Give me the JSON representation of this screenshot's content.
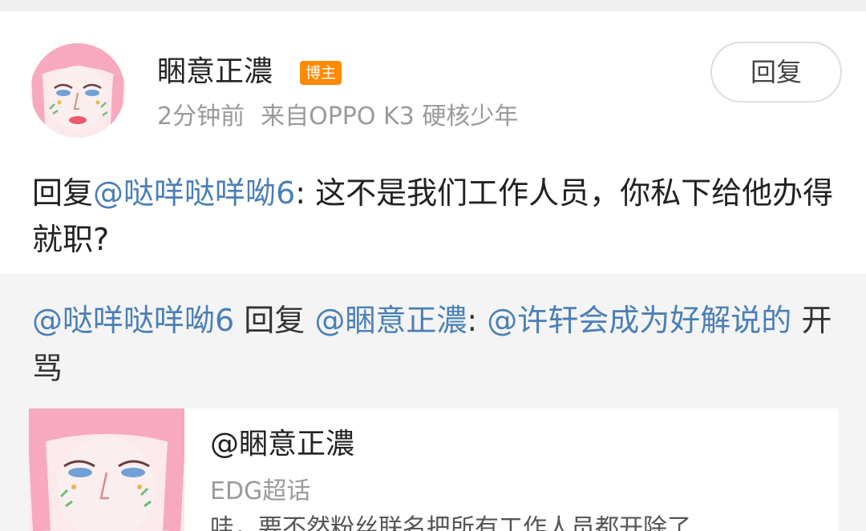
{
  "comment": {
    "username": "睏意正濃",
    "badge": "博主",
    "time": "2分钟前",
    "source": "来自OPPO K3 硬核少年",
    "reply_button": "回复",
    "text": {
      "prefix": "回复",
      "mention": "@哒咩哒咩呦6",
      "body": ": 这不是我们工作人员，你私下给他办得就职?"
    }
  },
  "thread": {
    "author_mention": "@哒咩哒咩呦6",
    "reply_word": " 回复 ",
    "target_mention": "@睏意正濃",
    "separator": ": ",
    "inner_mention": "@许轩会成为好解说的",
    "tail": " 开骂"
  },
  "share_card": {
    "title": "@睏意正濃",
    "subtitle": "EDG超话",
    "excerpt": "哇，要不然粉丝联名把所有工作人员都开除了"
  },
  "colors": {
    "mention": "#4a7fb6",
    "badge": "#ff8a00",
    "thread_background": "#f4f4f4"
  }
}
